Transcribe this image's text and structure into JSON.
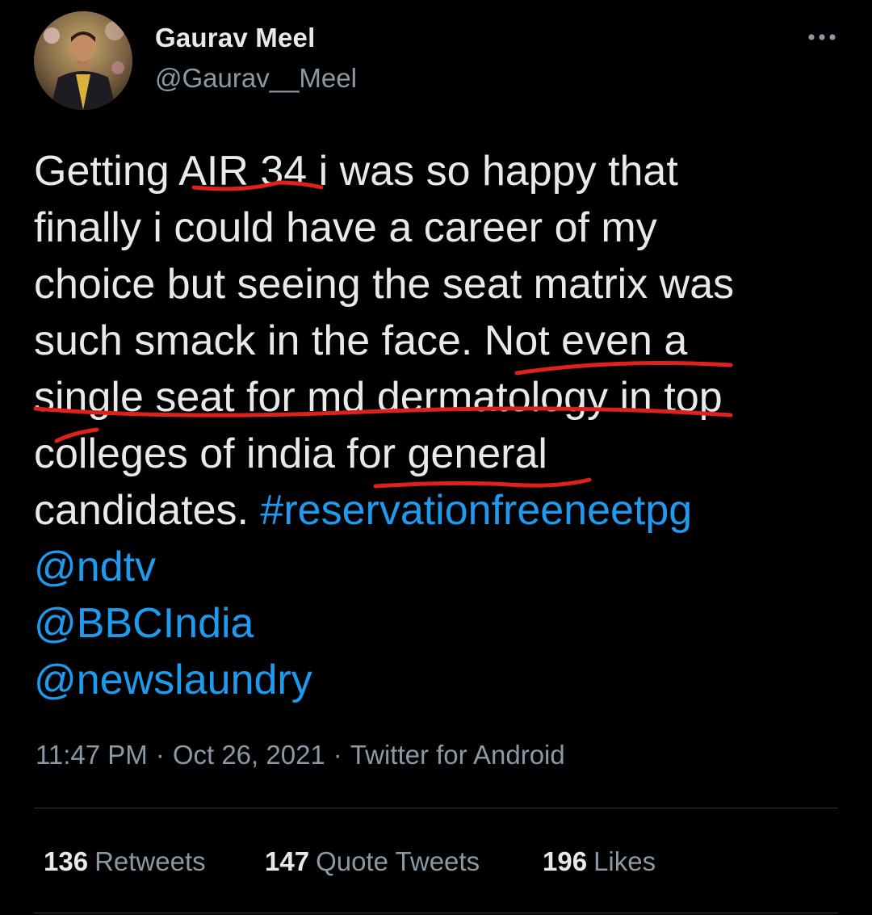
{
  "author": {
    "name": "Gaurav Meel",
    "handle": "@Gaurav__Meel"
  },
  "more_icon": "more-horizontal-icon",
  "tweet": {
    "lines": [
      {
        "parts": [
          {
            "text": "Getting AIR 34 i was so happy that",
            "type": "text"
          }
        ]
      },
      {
        "parts": [
          {
            "text": "finally i could have a career of my",
            "type": "text"
          }
        ]
      },
      {
        "parts": [
          {
            "text": "choice but seeing the seat matrix was",
            "type": "text"
          }
        ]
      },
      {
        "parts": [
          {
            "text": "such smack in the face. Not even a",
            "type": "text"
          }
        ]
      },
      {
        "parts": [
          {
            "text": "single seat for md dermatology in top",
            "type": "text"
          }
        ]
      },
      {
        "parts": [
          {
            "text": "colleges of india for general",
            "type": "text"
          }
        ]
      },
      {
        "parts": [
          {
            "text": "candidates. ",
            "type": "text"
          },
          {
            "text": "#reservationfreeneetpg",
            "type": "hashtag"
          }
        ]
      },
      {
        "parts": [
          {
            "text": "@ndtv",
            "type": "mention"
          }
        ]
      },
      {
        "parts": [
          {
            "text": "@BBCIndia",
            "type": "mention"
          }
        ]
      },
      {
        "parts": [
          {
            "text": "@newslaundry",
            "type": "mention"
          }
        ]
      }
    ]
  },
  "meta": {
    "time": "11:47 PM",
    "separator": "·",
    "date": "Oct 26, 2021",
    "source": "Twitter for Android"
  },
  "stats": {
    "retweets": {
      "count": "136",
      "label": "Retweets"
    },
    "quote_tweets": {
      "count": "147",
      "label": "Quote Tweets"
    },
    "likes": {
      "count": "196",
      "label": "Likes"
    }
  },
  "colors": {
    "background": "#000000",
    "text": "#e7e9ea",
    "secondary": "#8b98a5",
    "link": "#1d9bf0",
    "annotation": "#e0201c",
    "divider": "#2f3336"
  }
}
